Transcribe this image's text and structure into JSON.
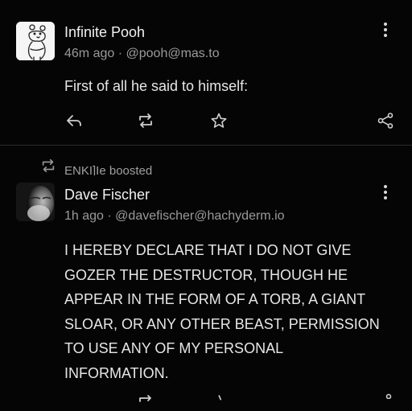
{
  "colors": {
    "background": "#050505",
    "text": "#e9e9e9",
    "meta": "#9a9a9a",
    "icon": "#cfcfcf"
  },
  "post1": {
    "author": "Infinite Pooh",
    "time": "46m ago",
    "separator": "·",
    "handle": "@pooh@mas.to",
    "content": "First of all he said to himself:",
    "avatar_icon": "pooh-sketch-avatar",
    "actions": [
      "reply-icon",
      "boost-icon",
      "favourite-icon",
      "share-icon"
    ]
  },
  "boost_banner": {
    "icon": "boost-icon",
    "text": "ENKI]Ie boosted"
  },
  "post2": {
    "author": "Dave Fischer",
    "time": "1h ago",
    "separator": "·",
    "handle": "@davefischer@hachyderm.io",
    "content_lines": [
      "I HEREBY DECLARE THAT I DO NOT GIVE",
      "GOZER THE DESTRUCTOR, THOUGH HE",
      "APPEAR IN THE FORM OF A TORB, A GIANT",
      "SLOAR, OR ANY OTHER BEAST, PERMISSION",
      "TO USE ANY OF MY PERSONAL",
      "INFORMATION."
    ],
    "avatar_icon": "bearded-man-photo-avatar"
  }
}
